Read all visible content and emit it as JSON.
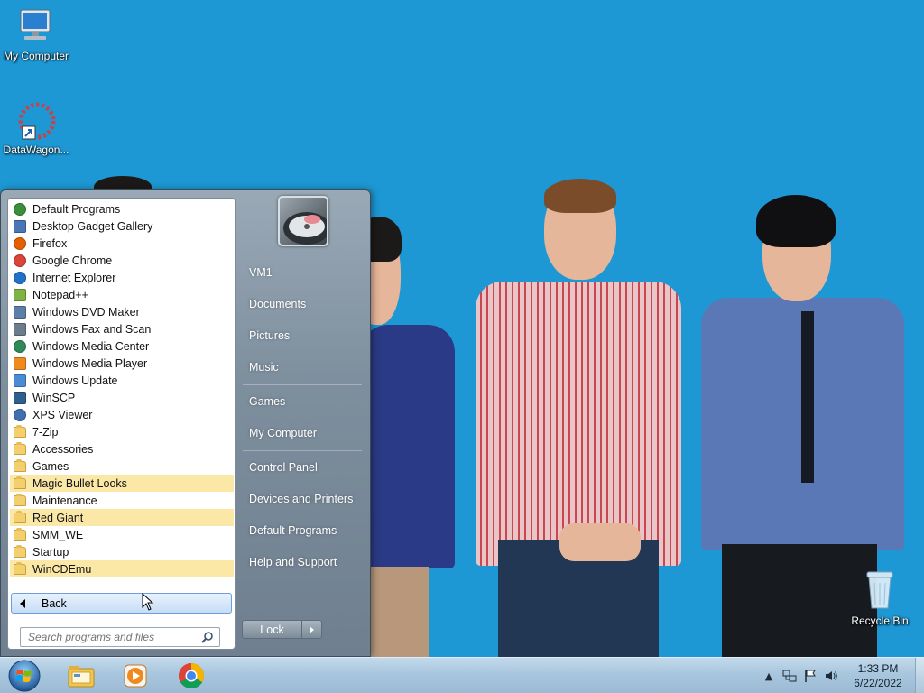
{
  "desktop": {
    "icons": [
      {
        "label": "My Computer"
      },
      {
        "label": "DataWagon..."
      },
      {
        "label": "Recycle Bin"
      }
    ]
  },
  "start_menu": {
    "programs": [
      {
        "label": "Default Programs",
        "icon": "default-programs-icon",
        "kind": "app"
      },
      {
        "label": "Desktop Gadget Gallery",
        "icon": "gadget-gallery-icon",
        "kind": "app"
      },
      {
        "label": "Firefox",
        "icon": "firefox-icon",
        "kind": "app"
      },
      {
        "label": "Google Chrome",
        "icon": "chrome-icon",
        "kind": "app"
      },
      {
        "label": "Internet Explorer",
        "icon": "ie-icon",
        "kind": "app"
      },
      {
        "label": "Notepad++",
        "icon": "notepadpp-icon",
        "kind": "app"
      },
      {
        "label": "Windows DVD Maker",
        "icon": "dvd-maker-icon",
        "kind": "app"
      },
      {
        "label": "Windows Fax and Scan",
        "icon": "fax-scan-icon",
        "kind": "app"
      },
      {
        "label": "Windows Media Center",
        "icon": "media-center-icon",
        "kind": "app"
      },
      {
        "label": "Windows Media Player",
        "icon": "media-player-icon",
        "kind": "app"
      },
      {
        "label": "Windows Update",
        "icon": "windows-update-icon",
        "kind": "app"
      },
      {
        "label": "WinSCP",
        "icon": "winscp-icon",
        "kind": "app"
      },
      {
        "label": "XPS Viewer",
        "icon": "xps-viewer-icon",
        "kind": "app"
      },
      {
        "label": "7-Zip",
        "icon": "folder-icon",
        "kind": "folder"
      },
      {
        "label": "Accessories",
        "icon": "folder-icon",
        "kind": "folder"
      },
      {
        "label": "Games",
        "icon": "folder-icon",
        "kind": "folder"
      },
      {
        "label": "Magic Bullet Looks",
        "icon": "folder-icon",
        "kind": "folder",
        "highlight": true
      },
      {
        "label": "Maintenance",
        "icon": "folder-icon",
        "kind": "folder"
      },
      {
        "label": "Red Giant",
        "icon": "folder-icon",
        "kind": "folder",
        "highlight": true
      },
      {
        "label": "SMM_WE",
        "icon": "folder-icon",
        "kind": "folder"
      },
      {
        "label": "Startup",
        "icon": "folder-icon",
        "kind": "folder"
      },
      {
        "label": "WinCDEmu",
        "icon": "folder-icon",
        "kind": "folder",
        "highlight": true
      }
    ],
    "back_label": "Back",
    "search_placeholder": "Search programs and files",
    "right_links": {
      "user": "VM1",
      "documents": "Documents",
      "pictures": "Pictures",
      "music": "Music",
      "games": "Games",
      "computer": "My Computer",
      "control_panel": "Control Panel",
      "devices": "Devices and Printers",
      "default_programs": "Default Programs",
      "help": "Help and Support"
    },
    "lock_label": "Lock"
  },
  "taskbar": {
    "pinned": [
      "explorer-icon",
      "media-player-icon",
      "chrome-icon"
    ],
    "clock": {
      "time": "1:33 PM",
      "date": "6/22/2022"
    }
  },
  "colors": {
    "wallpaper": "#1d98d4",
    "highlight": "#fbe8a6"
  }
}
